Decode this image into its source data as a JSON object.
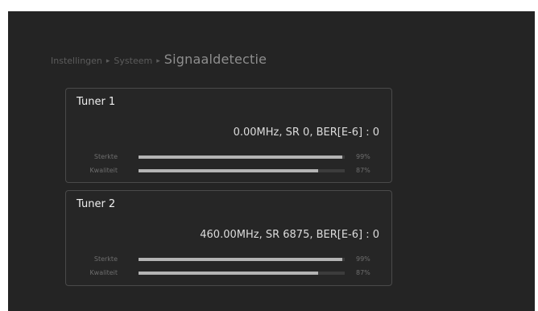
{
  "breadcrumb": {
    "items": [
      "Instellingen",
      "Systeem"
    ],
    "separator": "▸",
    "current": "Signaaldetectie"
  },
  "tuners": [
    {
      "title": "Tuner 1",
      "info": "0.00MHz, SR 0, BER[E-6] : 0",
      "strength": {
        "label": "Sterkte",
        "value_text": "99%",
        "value": 99
      },
      "quality": {
        "label": "Kwaliteit",
        "value_text": "87%",
        "value": 87
      }
    },
    {
      "title": "Tuner 2",
      "info": "460.00MHz, SR 6875, BER[E-6] : 0",
      "strength": {
        "label": "Sterkte",
        "value_text": "99%",
        "value": 99
      },
      "quality": {
        "label": "Kwaliteit",
        "value_text": "87%",
        "value": 87
      }
    }
  ]
}
